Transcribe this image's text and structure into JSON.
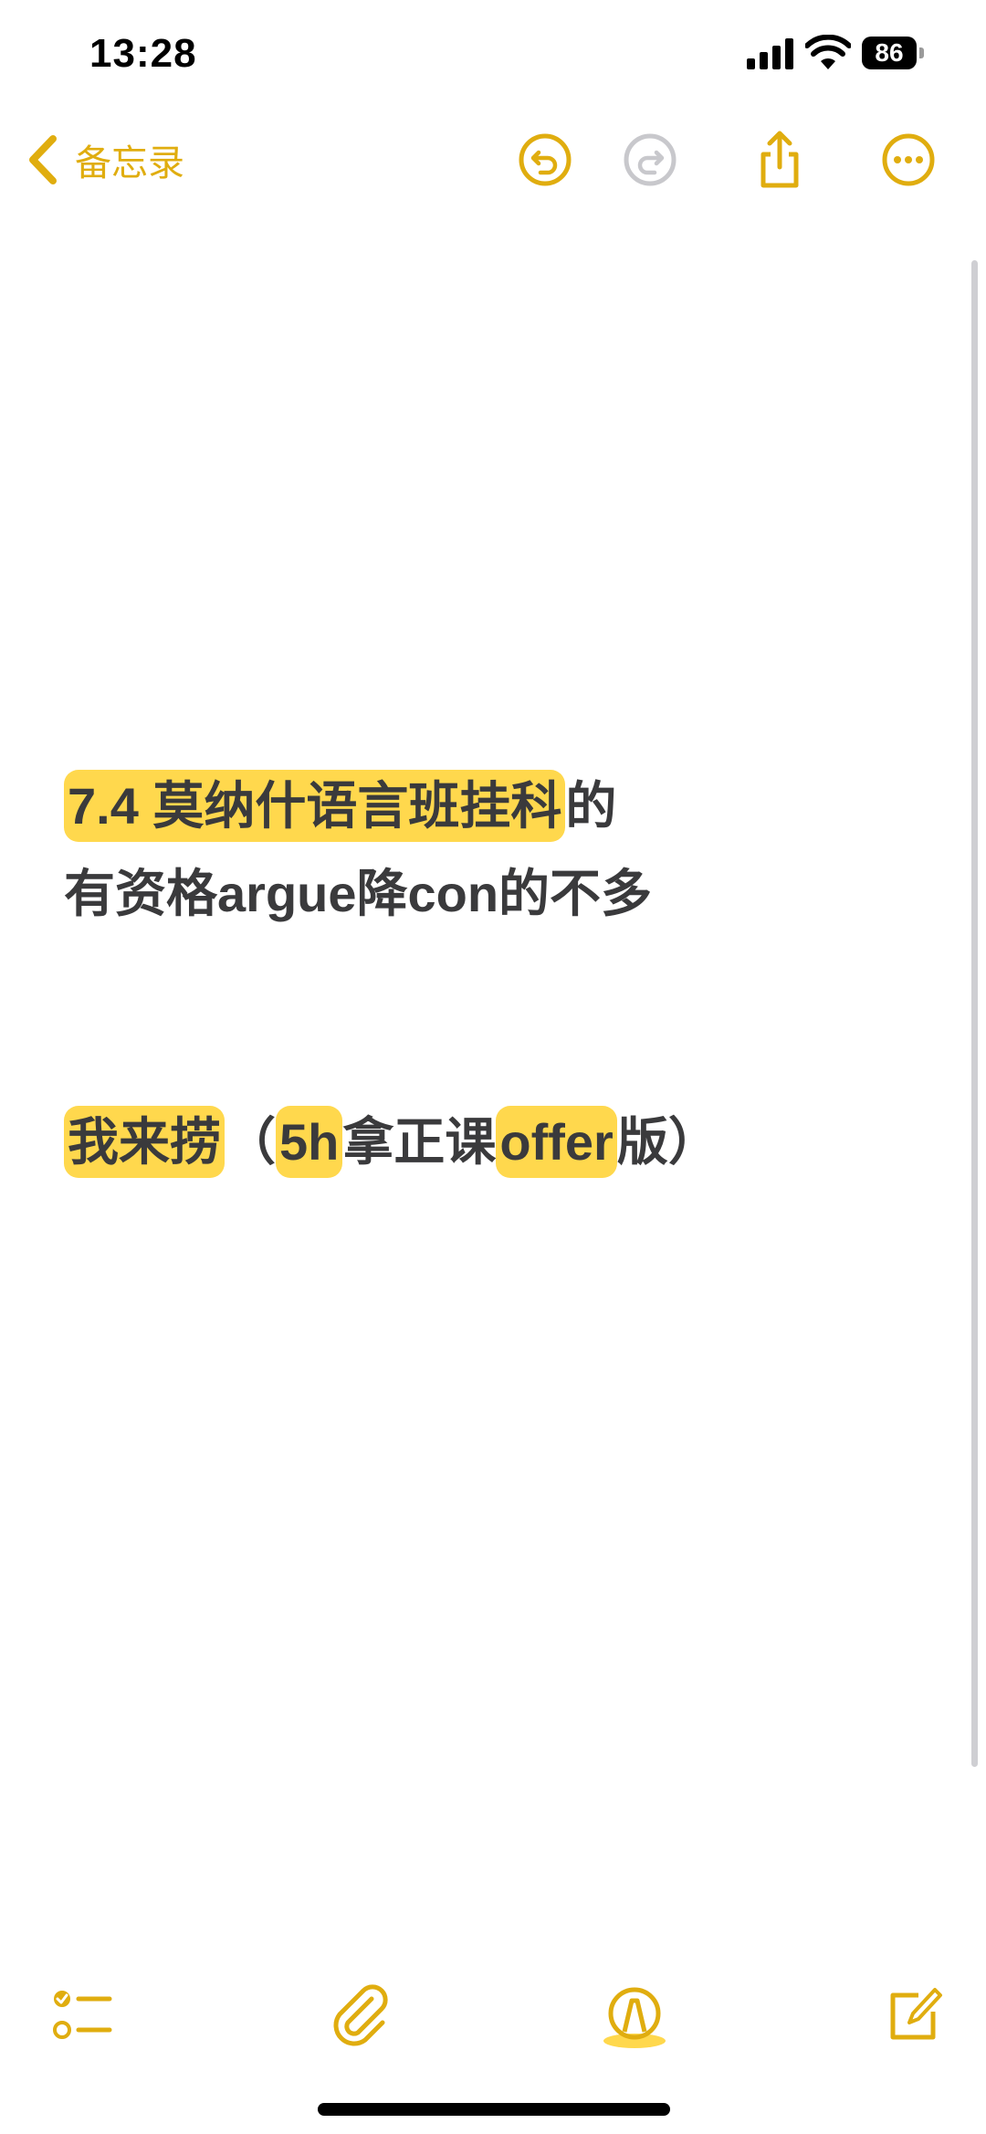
{
  "status_bar": {
    "time": "13:28",
    "battery_level": "86",
    "icons": [
      "cellular-signal-icon",
      "wifi-icon",
      "battery-icon"
    ]
  },
  "nav": {
    "back_label": "备忘录",
    "icons": [
      "chevron-left-icon",
      "undo-icon",
      "redo-icon",
      "share-icon",
      "more-icon"
    ]
  },
  "note": {
    "line1_highlight": "7.4 莫纳什语言班挂科",
    "line1_rest": "的",
    "line2": "有资格argue降con的不多",
    "line3_part1": "我来捞",
    "line3_part2": "（",
    "line3_part3": "5h",
    "line3_part4": "拿正课",
    "line3_part5": "offer",
    "line3_part6": "版）"
  },
  "toolbar": {
    "icons": [
      "checklist-icon",
      "attachment-icon",
      "markup-icon",
      "compose-icon"
    ]
  },
  "colors": {
    "accent": "#e0ad0f",
    "highlight": "#ffd84d",
    "text": "#3a3a3c"
  }
}
